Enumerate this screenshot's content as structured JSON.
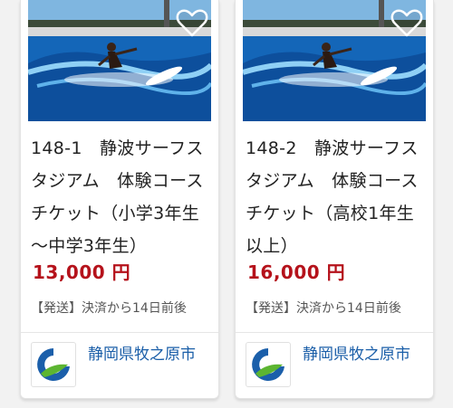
{
  "products": [
    {
      "title": "148-1　静波サーフスタジアム　体験コースチケット（小学3年生～中学3年生）",
      "price": "13,000 円",
      "shipping": "【発送】決済から14日前後",
      "seller": "静岡県牧之原市",
      "favorite_icon": "heart-outline-icon",
      "logo_icon": "city-emblem-icon"
    },
    {
      "title": "148-2　静波サーフスタジアム　体験コースチケット（高校1年生以上）",
      "price": "16,000 円",
      "shipping": "【発送】決済から14日前後",
      "seller": "静岡県牧之原市",
      "favorite_icon": "heart-outline-icon",
      "logo_icon": "city-emblem-icon"
    }
  ],
  "colors": {
    "price": "#b5121b",
    "seller_link": "#1a5ea8",
    "emblem_blue": "#1b5faa",
    "emblem_green": "#5cb531"
  }
}
